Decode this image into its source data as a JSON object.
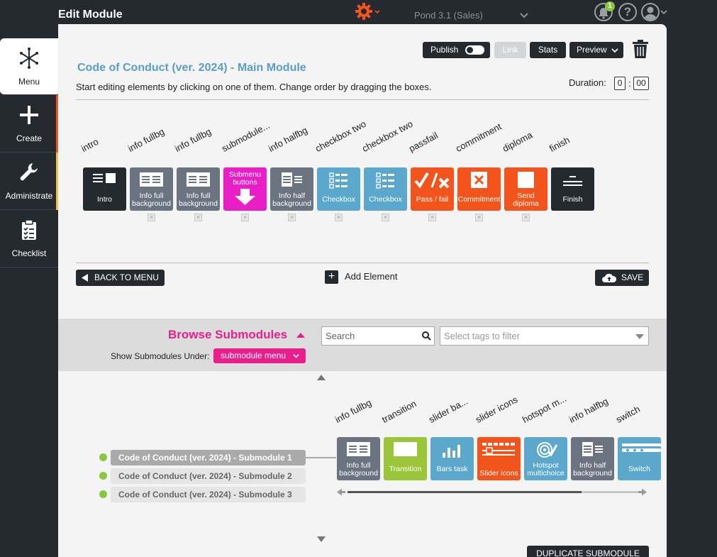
{
  "header": {
    "title": "Edit Module",
    "environment": "Pond 3.1 (Sales)",
    "notifications_count": "1",
    "help_label": "?"
  },
  "sidebar": {
    "items": [
      {
        "label": "Menu",
        "icon": "snowflake-icon"
      },
      {
        "label": "Create",
        "icon": "plus-icon"
      },
      {
        "label": "Administrate",
        "icon": "wrench-icon"
      },
      {
        "label": "Checklist",
        "icon": "clipboard-icon"
      }
    ]
  },
  "toolbar": {
    "publish_label": "Publish",
    "link_label": "Link",
    "stats_label": "Stats",
    "preview_label": "Preview"
  },
  "module": {
    "title": "Code of Conduct (ver. 2024) - Main Module",
    "instructions": "Start editing elements by clicking on one of them. Change order by dragging the boxes.",
    "duration_label": "Duration:",
    "duration_hours": "0",
    "duration_minutes": "00",
    "elements": [
      {
        "caption": "intro",
        "label": "Intro",
        "color": "#252a31"
      },
      {
        "caption": "info fullbg",
        "label": "Info full background",
        "color": "#6b7380"
      },
      {
        "caption": "info fullbg",
        "label": "Info full background",
        "color": "#6b7380"
      },
      {
        "caption": "submodule...",
        "label": "Submenu buttons",
        "color": "#e91ec7"
      },
      {
        "caption": "info halfbg",
        "label": "Info half background",
        "color": "#6b7380"
      },
      {
        "caption": "checkbox two",
        "label": "Checkbox",
        "color": "#5ba8cc"
      },
      {
        "caption": "checkbox two",
        "label": "Checkbox",
        "color": "#5ba8cc"
      },
      {
        "caption": "passfail",
        "label": "Pass / fail",
        "color": "#f2541b"
      },
      {
        "caption": "commitment",
        "label": "Commitment",
        "color": "#f2541b"
      },
      {
        "caption": "diploma",
        "label": "Send diploma",
        "color": "#f2541b"
      },
      {
        "caption": "finish",
        "label": "Finish",
        "color": "#252a31"
      }
    ],
    "back_label": "BACK TO MENU",
    "add_label": "Add Element",
    "save_label": "SAVE"
  },
  "browse": {
    "title": "Browse Submodules",
    "show_under_label": "Show Submodules Under:",
    "show_under_value": "submodule menu",
    "search_placeholder": "Search",
    "tags_placeholder": "Select tags to filter",
    "submodules": [
      "Code of Conduct (ver. 2024) - Submodule 1",
      "Code of Conduct (ver. 2024) - Submodule 2",
      "Code of Conduct (ver. 2024) - Submodule 3"
    ],
    "sub_elements": [
      {
        "caption": "info fullbg",
        "label": "Info full background",
        "color": "#6b7380"
      },
      {
        "caption": "transition",
        "label": "Transition",
        "color": "#9cc63a"
      },
      {
        "caption": "slider ba...",
        "label": "Bars task",
        "color": "#5ba8cc"
      },
      {
        "caption": "slider icons",
        "label": "Slider icons",
        "color": "#f2541b"
      },
      {
        "caption": "hotspot m...",
        "label": "Hotspot multichoice",
        "color": "#5ba8cc"
      },
      {
        "caption": "info halfbg",
        "label": "Info half background",
        "color": "#6b7380"
      },
      {
        "caption": "switch",
        "label": "Switch",
        "color": "#5ba8cc"
      }
    ],
    "duplicate_label": "DUPLICATE SUBMODULE"
  }
}
